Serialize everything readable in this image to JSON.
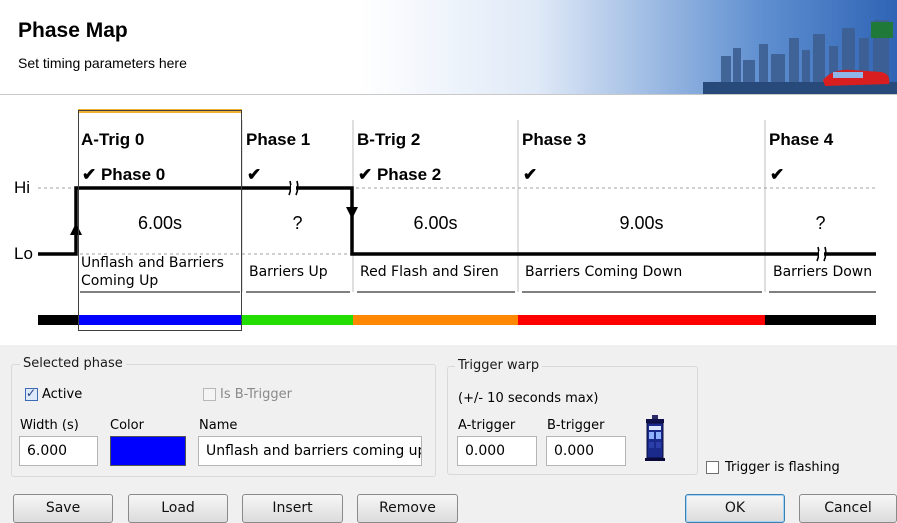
{
  "header": {
    "title": "Phase Map",
    "subtitle": "Set timing parameters here"
  },
  "timeline": {
    "hi_label": "Hi",
    "lo_label": "Lo",
    "phases": [
      {
        "header": "A-Trig 0",
        "check": "✔ Phase 0",
        "duration": "6.00s",
        "name_line1": "Unflash and Barriers",
        "name_line2": "Coming Up",
        "color": "#0000ff",
        "selected": true
      },
      {
        "header": "Phase 1",
        "check": "✔",
        "duration": "?",
        "name_line1": "Barriers Up",
        "name_line2": "",
        "color": "#22dd00"
      },
      {
        "header": "B-Trig 2",
        "check": "✔ Phase 2",
        "duration": "6.00s",
        "name_line1": "Red Flash and Siren",
        "name_line2": "",
        "color": "#ff8800"
      },
      {
        "header": "Phase 3",
        "check": "✔",
        "duration": "9.00s",
        "name_line1": "Barriers Coming Down",
        "name_line2": "",
        "color": "#ff0000"
      },
      {
        "header": "Phase 4",
        "check": "✔",
        "duration": "?",
        "name_line1": "Barriers Down",
        "name_line2": "",
        "color": "#000000"
      }
    ]
  },
  "selected_phase": {
    "group_label": "Selected phase",
    "active_label": "Active",
    "active_checked": true,
    "b_trigger_label": "Is B-Trigger",
    "b_trigger_checked": false,
    "width_label": "Width (s)",
    "width_value": "6.000",
    "color_label": "Color",
    "color_value": "#0000ff",
    "name_label": "Name",
    "name_value": "Unflash and barriers coming up"
  },
  "trigger_warp": {
    "group_label": "Trigger warp",
    "limit_text": "(+/- 10 seconds max)",
    "a_trigger_label": "A-trigger",
    "a_trigger_value": "0.000",
    "b_trigger_label": "B-trigger",
    "b_trigger_value": "0.000",
    "icon": "police-box-icon"
  },
  "trigger_flashing": {
    "label": "Trigger is flashing",
    "checked": false
  },
  "buttons": {
    "save": "Save",
    "load": "Load",
    "insert": "Insert",
    "remove": "Remove",
    "ok": "OK",
    "cancel": "Cancel"
  }
}
